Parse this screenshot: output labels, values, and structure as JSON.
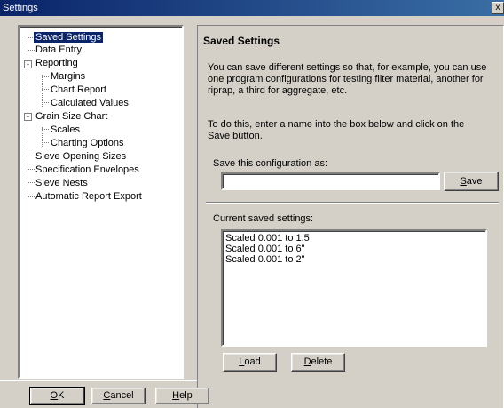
{
  "window": {
    "title": "Settings",
    "close_glyph": "x"
  },
  "tree": {
    "items": [
      {
        "label": "Saved Settings",
        "level": 0,
        "selected": true
      },
      {
        "label": "Data Entry",
        "level": 0
      },
      {
        "label": "Reporting",
        "level": 0,
        "expander": "-"
      },
      {
        "label": "Margins",
        "level": 1
      },
      {
        "label": "Chart Report",
        "level": 1
      },
      {
        "label": "Calculated Values",
        "level": 1
      },
      {
        "label": "Grain Size Chart",
        "level": 0,
        "expander": "-"
      },
      {
        "label": "Scales",
        "level": 1
      },
      {
        "label": "Charting Options",
        "level": 1
      },
      {
        "label": "Sieve Opening Sizes",
        "level": 0
      },
      {
        "label": "Specification Envelopes",
        "level": 0
      },
      {
        "label": "Sieve Nests",
        "level": 0
      },
      {
        "label": "Automatic Report Export",
        "level": 0
      }
    ]
  },
  "content": {
    "heading": "Saved Settings",
    "intro_lines": [
      "You can save different settings so that, for example, you can use",
      "one program configurations for testing filter material, another for",
      "riprap, a third for aggregate, etc."
    ],
    "instruction_lines": [
      "To do this, enter a name into the box below and click on the",
      "Save button."
    ],
    "save_label": "Save this configuration as:",
    "save_input_value": "",
    "save_button_prefix": "",
    "save_button_accel": "S",
    "save_button_rest": "ave",
    "current_label": "Current saved settings:",
    "saved_settings": [
      "Scaled 0.001 to 1.5",
      "Scaled 0.001 to 6\"",
      "Scaled 0.001 to 2\""
    ],
    "load_accel": "L",
    "load_rest": "oad",
    "delete_accel": "D",
    "delete_rest": "elete"
  },
  "footer": {
    "ok_accel": "O",
    "ok_rest": "K",
    "cancel_accel": "C",
    "cancel_rest": "ancel",
    "help_accel": "H",
    "help_rest": "elp"
  }
}
